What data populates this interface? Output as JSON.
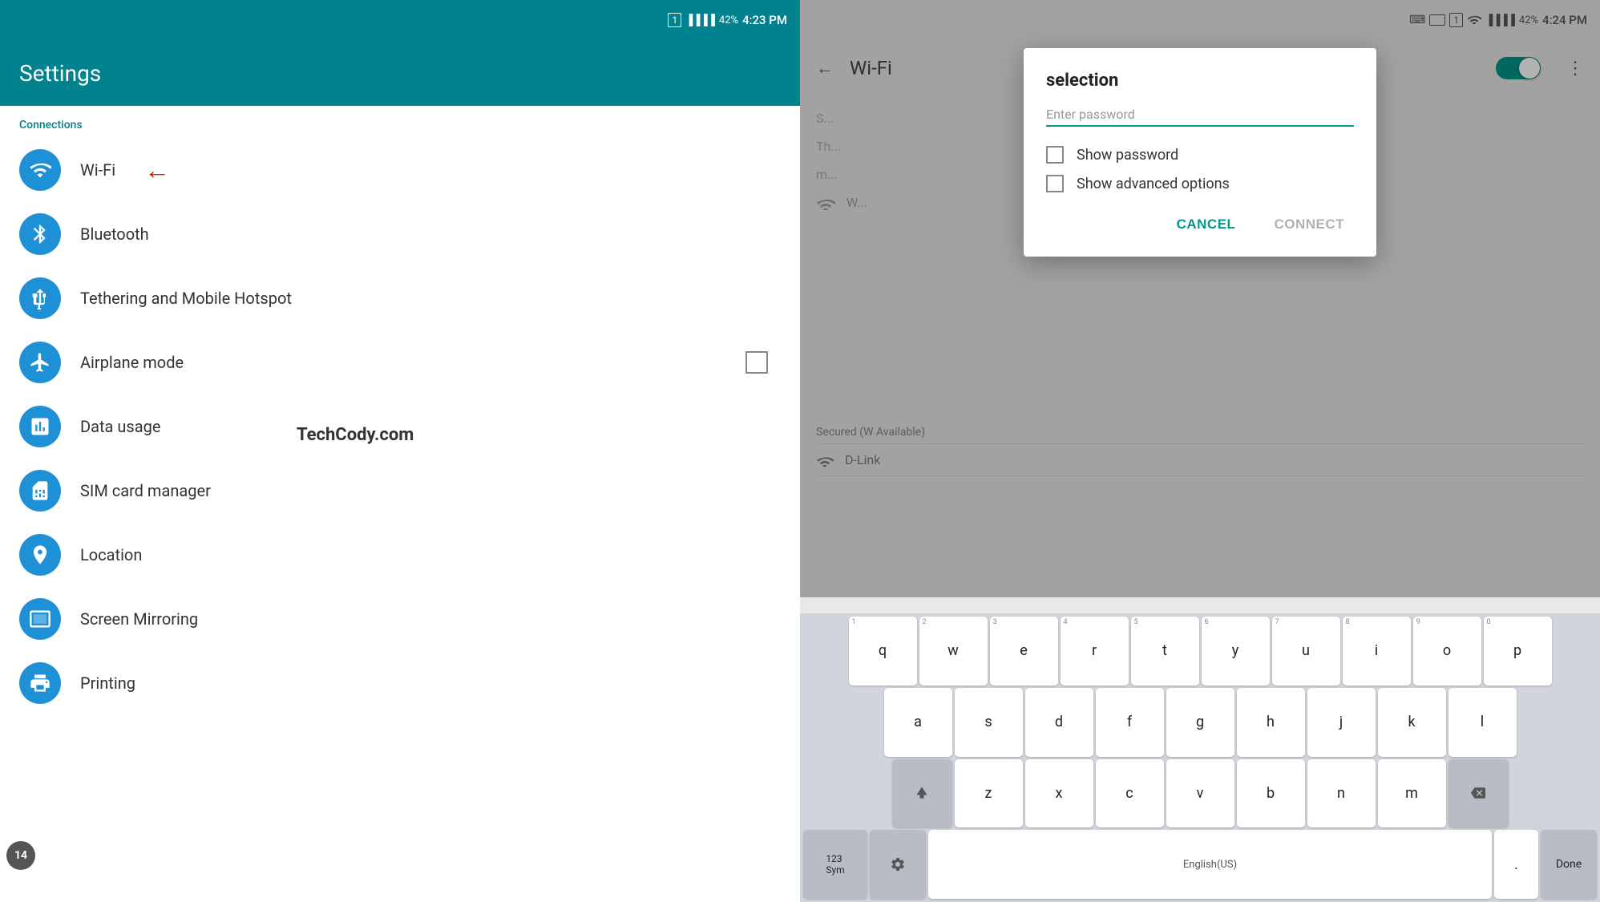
{
  "left": {
    "statusBar": {
      "simIcon": "1",
      "signal1": "▐▐▐",
      "signal2": "▐▐▐▐",
      "battery": "42%",
      "time": "4:23 PM"
    },
    "header": {
      "title": "Settings"
    },
    "sections": [
      {
        "label": "Connections",
        "items": [
          {
            "id": "wifi",
            "label": "Wi-Fi",
            "hasArrow": true,
            "hasCheckbox": false
          },
          {
            "id": "bluetooth",
            "label": "Bluetooth",
            "hasArrow": false,
            "hasCheckbox": false
          },
          {
            "id": "tethering",
            "label": "Tethering and Mobile Hotspot",
            "hasArrow": false,
            "hasCheckbox": false
          },
          {
            "id": "airplane",
            "label": "Airplane mode",
            "hasArrow": false,
            "hasCheckbox": true
          },
          {
            "id": "data",
            "label": "Data usage",
            "hasArrow": false,
            "hasCheckbox": false
          },
          {
            "id": "sim",
            "label": "SIM card manager",
            "hasArrow": false,
            "hasCheckbox": false
          },
          {
            "id": "location",
            "label": "Location",
            "hasArrow": false,
            "hasCheckbox": false
          },
          {
            "id": "mirror",
            "label": "Screen Mirroring",
            "hasArrow": false,
            "hasCheckbox": false
          },
          {
            "id": "printing",
            "label": "Printing",
            "hasArrow": false,
            "hasCheckbox": false
          }
        ]
      }
    ],
    "watermark": "TechCody.com",
    "badge": "14"
  },
  "right": {
    "statusBar": {
      "keyboard": "⌨",
      "simIcon": "1",
      "wifi": "wifi",
      "signal1": "▐▐▐",
      "signal2": "▐▐▐▐",
      "battery": "42%",
      "time": "4:24 PM"
    },
    "header": {
      "backLabel": "←",
      "title": "Wi-Fi",
      "moreLabel": "⋮"
    },
    "dialog": {
      "title": "selection",
      "passwordPlaceholder": "Enter password",
      "passwordValue": "",
      "showPasswordLabel": "Show password",
      "showPasswordChecked": false,
      "showAdvancedLabel": "Show advanced options",
      "showAdvancedChecked": false,
      "cancelLabel": "CANCEL",
      "connectLabel": "CONNECT"
    },
    "wifiNetworks": [
      {
        "name": "S...",
        "status": ""
      },
      {
        "name": "Th...",
        "status": ""
      },
      {
        "name": "m...",
        "status": ""
      },
      {
        "name": "W...",
        "status": ""
      },
      {
        "name": "Secured (W Available)",
        "status": ""
      },
      {
        "name": "D-Link",
        "status": ""
      }
    ],
    "keyboard": {
      "rows": [
        [
          "q",
          "w",
          "e",
          "r",
          "t",
          "y",
          "u",
          "i",
          "o",
          "p"
        ],
        [
          "a",
          "s",
          "d",
          "f",
          "g",
          "h",
          "j",
          "k",
          "l"
        ],
        [
          "z",
          "x",
          "c",
          "v",
          "b",
          "n",
          "m"
        ],
        [
          "123\nSym",
          "⚙",
          "English(US)",
          ".",
          "↩"
        ]
      ],
      "numbers": [
        "1",
        "2",
        "3",
        "4",
        "5",
        "6",
        "7",
        "8",
        "9",
        "0"
      ],
      "doneLabel": "Done"
    }
  }
}
